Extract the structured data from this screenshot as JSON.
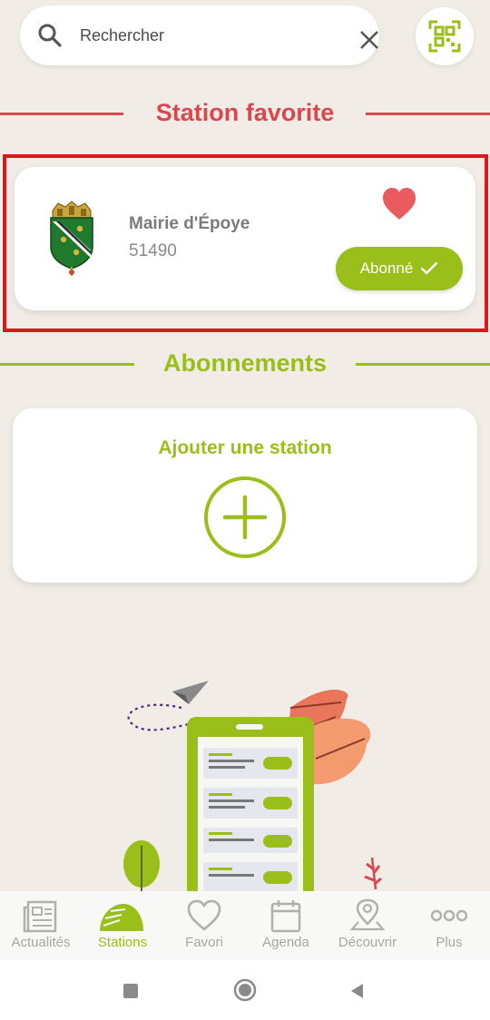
{
  "search": {
    "placeholder": "Rechercher"
  },
  "favorite_section": {
    "title": "Station favorite"
  },
  "favorite_station": {
    "name": "Mairie d'Époye",
    "postal_code": "51490",
    "subscribed_label": "Abonné"
  },
  "subscriptions_section": {
    "title": "Abonnements",
    "add_label": "Ajouter une station"
  },
  "nav": {
    "items": [
      {
        "label": "Actualités",
        "icon": "newspaper-icon"
      },
      {
        "label": "Stations",
        "icon": "stations-icon"
      },
      {
        "label": "Favori",
        "icon": "heart-icon"
      },
      {
        "label": "Agenda",
        "icon": "calendar-icon"
      },
      {
        "label": "Découvrir",
        "icon": "map-pin-icon"
      },
      {
        "label": "Plus",
        "icon": "more-icon"
      }
    ],
    "active": "Stations"
  },
  "colors": {
    "accent_green": "#9bbf1a",
    "accent_red": "#d9474f",
    "heart": "#eb5a5e",
    "background": "#f1ede6"
  }
}
